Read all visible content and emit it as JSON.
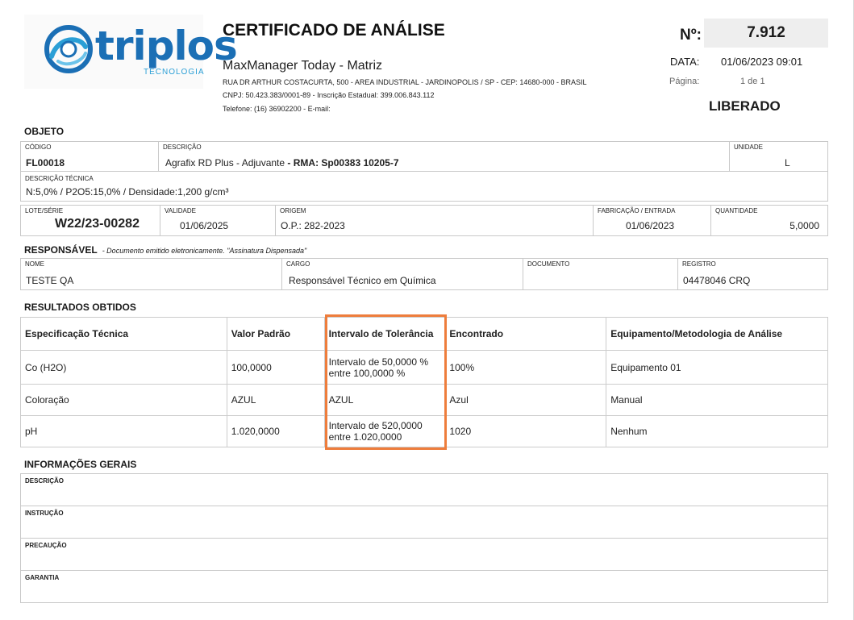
{
  "logo": {
    "word": "triplos",
    "sub": "TECNOLOGIA"
  },
  "header": {
    "title": "CERTIFICADO DE ANÁLISE",
    "company": "MaxManager Today - Matriz",
    "address": "RUA DR ARTHUR COSTACURTA, 500 - AREA INDUSTRIAL - JARDINOPOLIS / SP - CEP: 14680-000 - BRASIL",
    "cnpj": "CNPJ: 50.423.383/0001-89 - Inscrição Estadual: 399.006.843.112",
    "phone": "Telefone: (16) 36902200 - E-mail:",
    "number_label": "Nº:",
    "number": "7.912",
    "date_label": "DATA:",
    "date": "01/06/2023 09:01",
    "page_label": "Página:",
    "page": "1 de 1",
    "status": "LIBERADO"
  },
  "objeto": {
    "section": "OBJETO",
    "codigo_label": "CÓDIGO",
    "codigo": "FL00018",
    "descricao_label": "DESCRIÇÃO",
    "descricao": "Agrafix RD Plus - Adjuvante",
    "rma": "- RMA: Sp00383 10205-7",
    "unidade_label": "UNIDADE",
    "unidade": "L",
    "desc_tecnica_label": "DESCRIÇÃO TÉCNICA",
    "desc_tecnica": "N:5,0% / P2O5:15,0% / Densidade:1,200 g/cm³",
    "lote_label": "LOTE/SÉRIE",
    "lote": "W22/23-00282",
    "validade_label": "VALIDADE",
    "validade": "01/06/2025",
    "origem_label": "ORIGEM",
    "origem": "O.P.: 282-2023",
    "fabricacao_label": "FABRICAÇÃO / ENTRADA",
    "fabricacao": "01/06/2023",
    "quantidade_label": "QUANTIDADE",
    "quantidade": "5,0000"
  },
  "responsavel": {
    "section": "RESPONSÁVEL",
    "note": "- Documento emitido eletronicamente. \"Assinatura Dispensada\"",
    "nome_label": "NOME",
    "nome": "TESTE QA",
    "cargo_label": "CARGO",
    "cargo": "Responsável Técnico em Química",
    "documento_label": "DOCUMENTO",
    "documento": "",
    "registro_label": "REGISTRO",
    "registro": "04478046 CRQ"
  },
  "resultados": {
    "section": "RESULTADOS OBTIDOS",
    "headers": [
      "Especificação Técnica",
      "Valor Padrão",
      "Intervalo de Tolerância",
      "Encontrado",
      "Equipamento/Metodologia de Análise"
    ],
    "rows": [
      {
        "spec": "Co (H2O)",
        "padrao": "100,0000",
        "tol1": "Intervalo de 50,0000 %",
        "tol2": "entre 100,0000 %",
        "encontrado": "100%",
        "equip": "Equipamento 01"
      },
      {
        "spec": "Coloração",
        "padrao": "AZUL",
        "tol1": "AZUL",
        "tol2": "",
        "encontrado": "Azul",
        "equip": "Manual"
      },
      {
        "spec": "pH",
        "padrao": "1.020,0000",
        "tol1": "Intervalo de 520,0000",
        "tol2": "entre 1.020,0000",
        "encontrado": "1020",
        "equip": "Nenhum"
      }
    ]
  },
  "gerais": {
    "section": "INFORMAÇÕES GERAIS",
    "descricao": "DESCRIÇÃO",
    "instrucao": "INSTRUÇÃO",
    "precaucao": "PRECAUÇÃO",
    "garantia": "GARANTIA"
  },
  "colors": {
    "highlight": "#ee7d3c",
    "brand": "#1b6fb5"
  }
}
